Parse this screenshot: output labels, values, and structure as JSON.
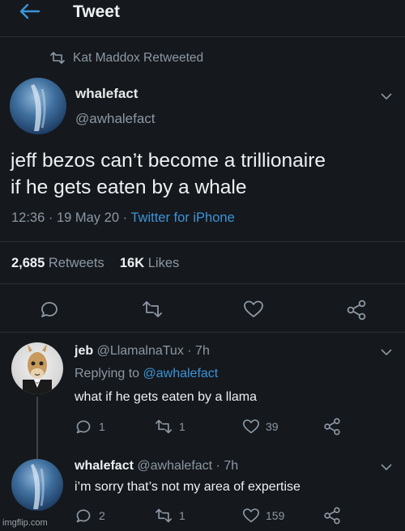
{
  "header": {
    "title": "Tweet"
  },
  "retweet_context": {
    "text": "Kat Maddox Retweeted"
  },
  "main_tweet": {
    "display_name": "whalefact",
    "handle": "@awhalefact",
    "text_line1": "jeff bezos can’t become a trillionaire",
    "text_line2": "if he gets eaten by a whale",
    "time": "12:36 · 19 May 20 · ",
    "source": "Twitter for iPhone",
    "retweets_count": "2,685",
    "retweets_label": "Retweets",
    "likes_count": "16K",
    "likes_label": "Likes"
  },
  "replies": [
    {
      "display_name": "jeb",
      "handle_time": "@LlamalnaTux · 7h",
      "replying_prefix": "Replying to ",
      "replying_to": "@awhalefact",
      "text": "what if he gets eaten by a llama",
      "reply_count": "1",
      "retweet_count": "1",
      "like_count": "39"
    },
    {
      "display_name": "whalefact",
      "handle_time": "@awhalefact · 7h",
      "text": "i’m sorry that’s not my area of expertise",
      "reply_count": "2",
      "retweet_count": "1",
      "like_count": "159"
    }
  ],
  "watermark": "imgflip.com",
  "colors": {
    "background": "#15181c",
    "muted": "#8b98a5",
    "link": "#3b94d9",
    "text": "#e7e9ea"
  }
}
